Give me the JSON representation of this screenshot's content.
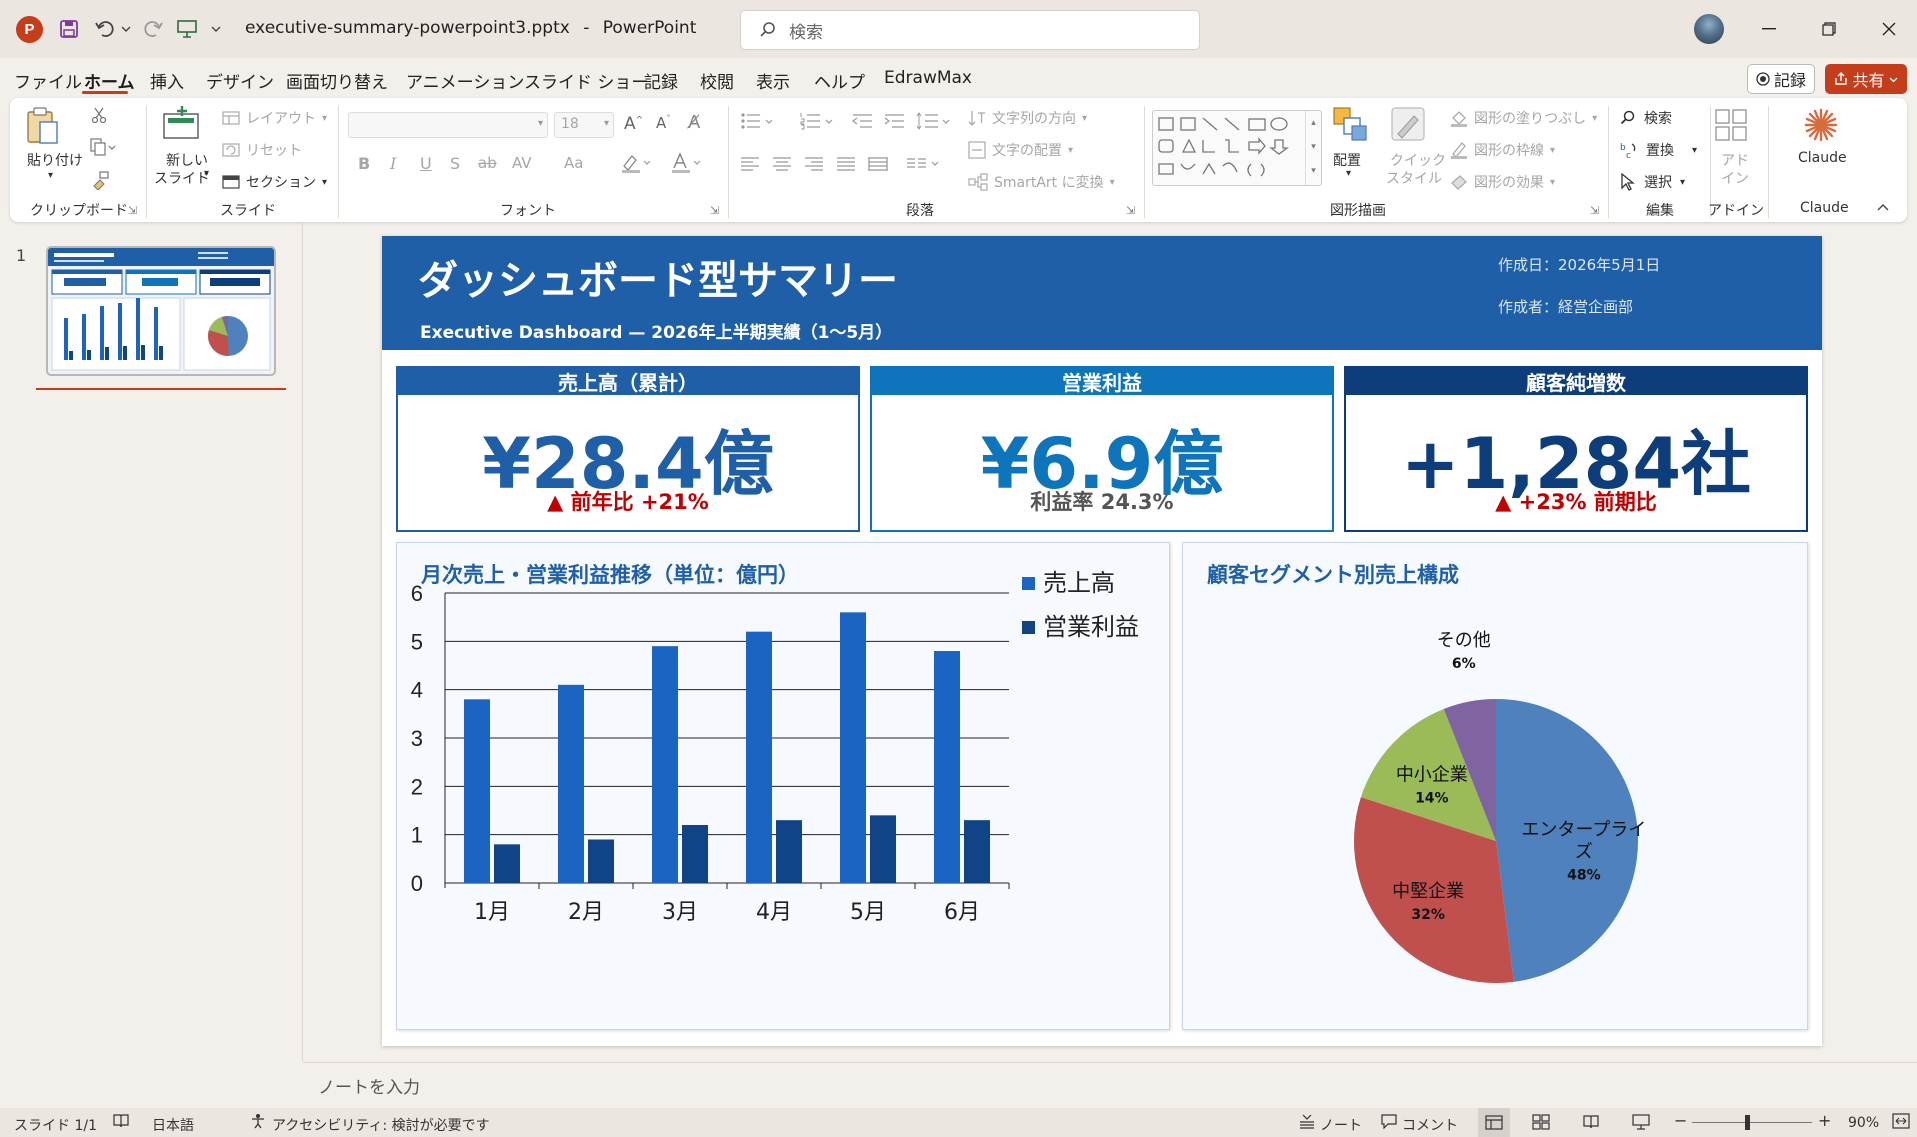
{
  "window": {
    "filename": "executive-summary-powerpoint3.pptx",
    "separator": "-",
    "app": "PowerPoint",
    "search_placeholder": "検索"
  },
  "menu": {
    "tabs": [
      "ファイル",
      "ホーム",
      "挿入",
      "デザイン",
      "画面切り替え",
      "アニメーション",
      "スライド ショー",
      "記録",
      "校閲",
      "表示",
      "ヘルプ",
      "EdrawMax"
    ],
    "active": "ホーム",
    "record_label": "記録",
    "share_label": "共有"
  },
  "ribbon": {
    "clipboard": {
      "paste": "貼り付け",
      "label": "クリップボード"
    },
    "slides": {
      "new_slide_1": "新しい",
      "new_slide_2": "スライド",
      "layout": "レイアウト",
      "reset": "リセット",
      "section": "セクション",
      "label": "スライド"
    },
    "font": {
      "font_size": "18",
      "bold": "B",
      "italic": "I",
      "underline": "U",
      "shadow": "S",
      "strike": "ab",
      "spacing": "AV",
      "case": "Aa",
      "label": "フォント"
    },
    "paragraph": {
      "text_direction": "文字列の方向",
      "align_text": "文字の配置",
      "smartart": "SmartArt に変換",
      "label": "段落"
    },
    "drawing": {
      "arrange": "配置",
      "quick_style_1": "クイック",
      "quick_style_2": "スタイル",
      "fill": "図形の塗りつぶし",
      "outline": "図形の枠線",
      "effects": "図形の効果",
      "label": "図形描画"
    },
    "editing": {
      "find": "検索",
      "replace": "置換",
      "select": "選択",
      "label": "編集"
    },
    "addins": {
      "addin_1": "アド",
      "addin_2": "イン",
      "label": "アドイン"
    },
    "claude": {
      "button": "Claude",
      "label": "Claude"
    }
  },
  "slide_panel": {
    "number": "1"
  },
  "slide": {
    "title": "ダッシュボード型サマリー",
    "subtitle": "Executive Dashboard — 2026年上半期実績（1〜5月）",
    "created_date": "作成日：2026年5月1日",
    "author": "作成者：経営企画部",
    "colors": {
      "header": "#1f5fa8",
      "navy": "#0d3d7a",
      "up": "#c00000",
      "accent": "#0e75bc"
    },
    "kpis": [
      {
        "label": "売上高（累計）",
        "value": "¥28.4億",
        "sub": "▲ 前年比 +21%",
        "color": "#1f5fa8",
        "value_color": "#1f5fa8",
        "sub_color": "#c00000"
      },
      {
        "label": "営業利益",
        "value": "¥6.9億",
        "sub": "利益率 24.3%",
        "color": "#0e75bc",
        "value_color": "#0e75bc",
        "sub_color": "#555555"
      },
      {
        "label": "顧客純増数",
        "value": "+1,284社",
        "sub": "▲ +23%  前期比",
        "color": "#0d3d7a",
        "value_color": "#0d3d7a",
        "sub_color": "#c00000"
      }
    ]
  },
  "chart_data": [
    {
      "type": "bar",
      "title": "月次売上・営業利益推移（単位：億円）",
      "categories": [
        "1月",
        "2月",
        "3月",
        "4月",
        "5月",
        "6月"
      ],
      "series": [
        {
          "name": "売上高",
          "values": [
            3.8,
            4.1,
            4.9,
            5.2,
            5.6,
            4.8
          ],
          "color": "#1c64c2"
        },
        {
          "name": "営業利益",
          "values": [
            0.8,
            0.9,
            1.2,
            1.3,
            1.4,
            1.3
          ],
          "color": "#114487"
        }
      ],
      "ylim": [
        0,
        6
      ],
      "yticks": [
        "0",
        "1",
        "2",
        "3",
        "4",
        "5",
        "6"
      ],
      "grid": true,
      "legend": "top-right"
    },
    {
      "type": "pie",
      "title": "顧客セグメント別売上構成",
      "slices": [
        {
          "label": "エンタープライズ",
          "pct_label": "48%",
          "value": 48,
          "color": "#4f81bd"
        },
        {
          "label": "中堅企業",
          "pct_label": "32%",
          "value": 32,
          "color": "#c0504d"
        },
        {
          "label": "中小企業",
          "pct_label": "14%",
          "value": 14,
          "color": "#9bbb59"
        },
        {
          "label": "その他",
          "pct_label": "6%",
          "value": 6,
          "color": "#8064a2"
        }
      ]
    }
  ],
  "notes": {
    "placeholder": "ノートを入力"
  },
  "status": {
    "slide": "スライド 1/1",
    "language": "日本語",
    "accessibility": "アクセシビリティ: 検討が必要です",
    "notes": "ノート",
    "comments": "コメント",
    "zoom": "90%"
  }
}
